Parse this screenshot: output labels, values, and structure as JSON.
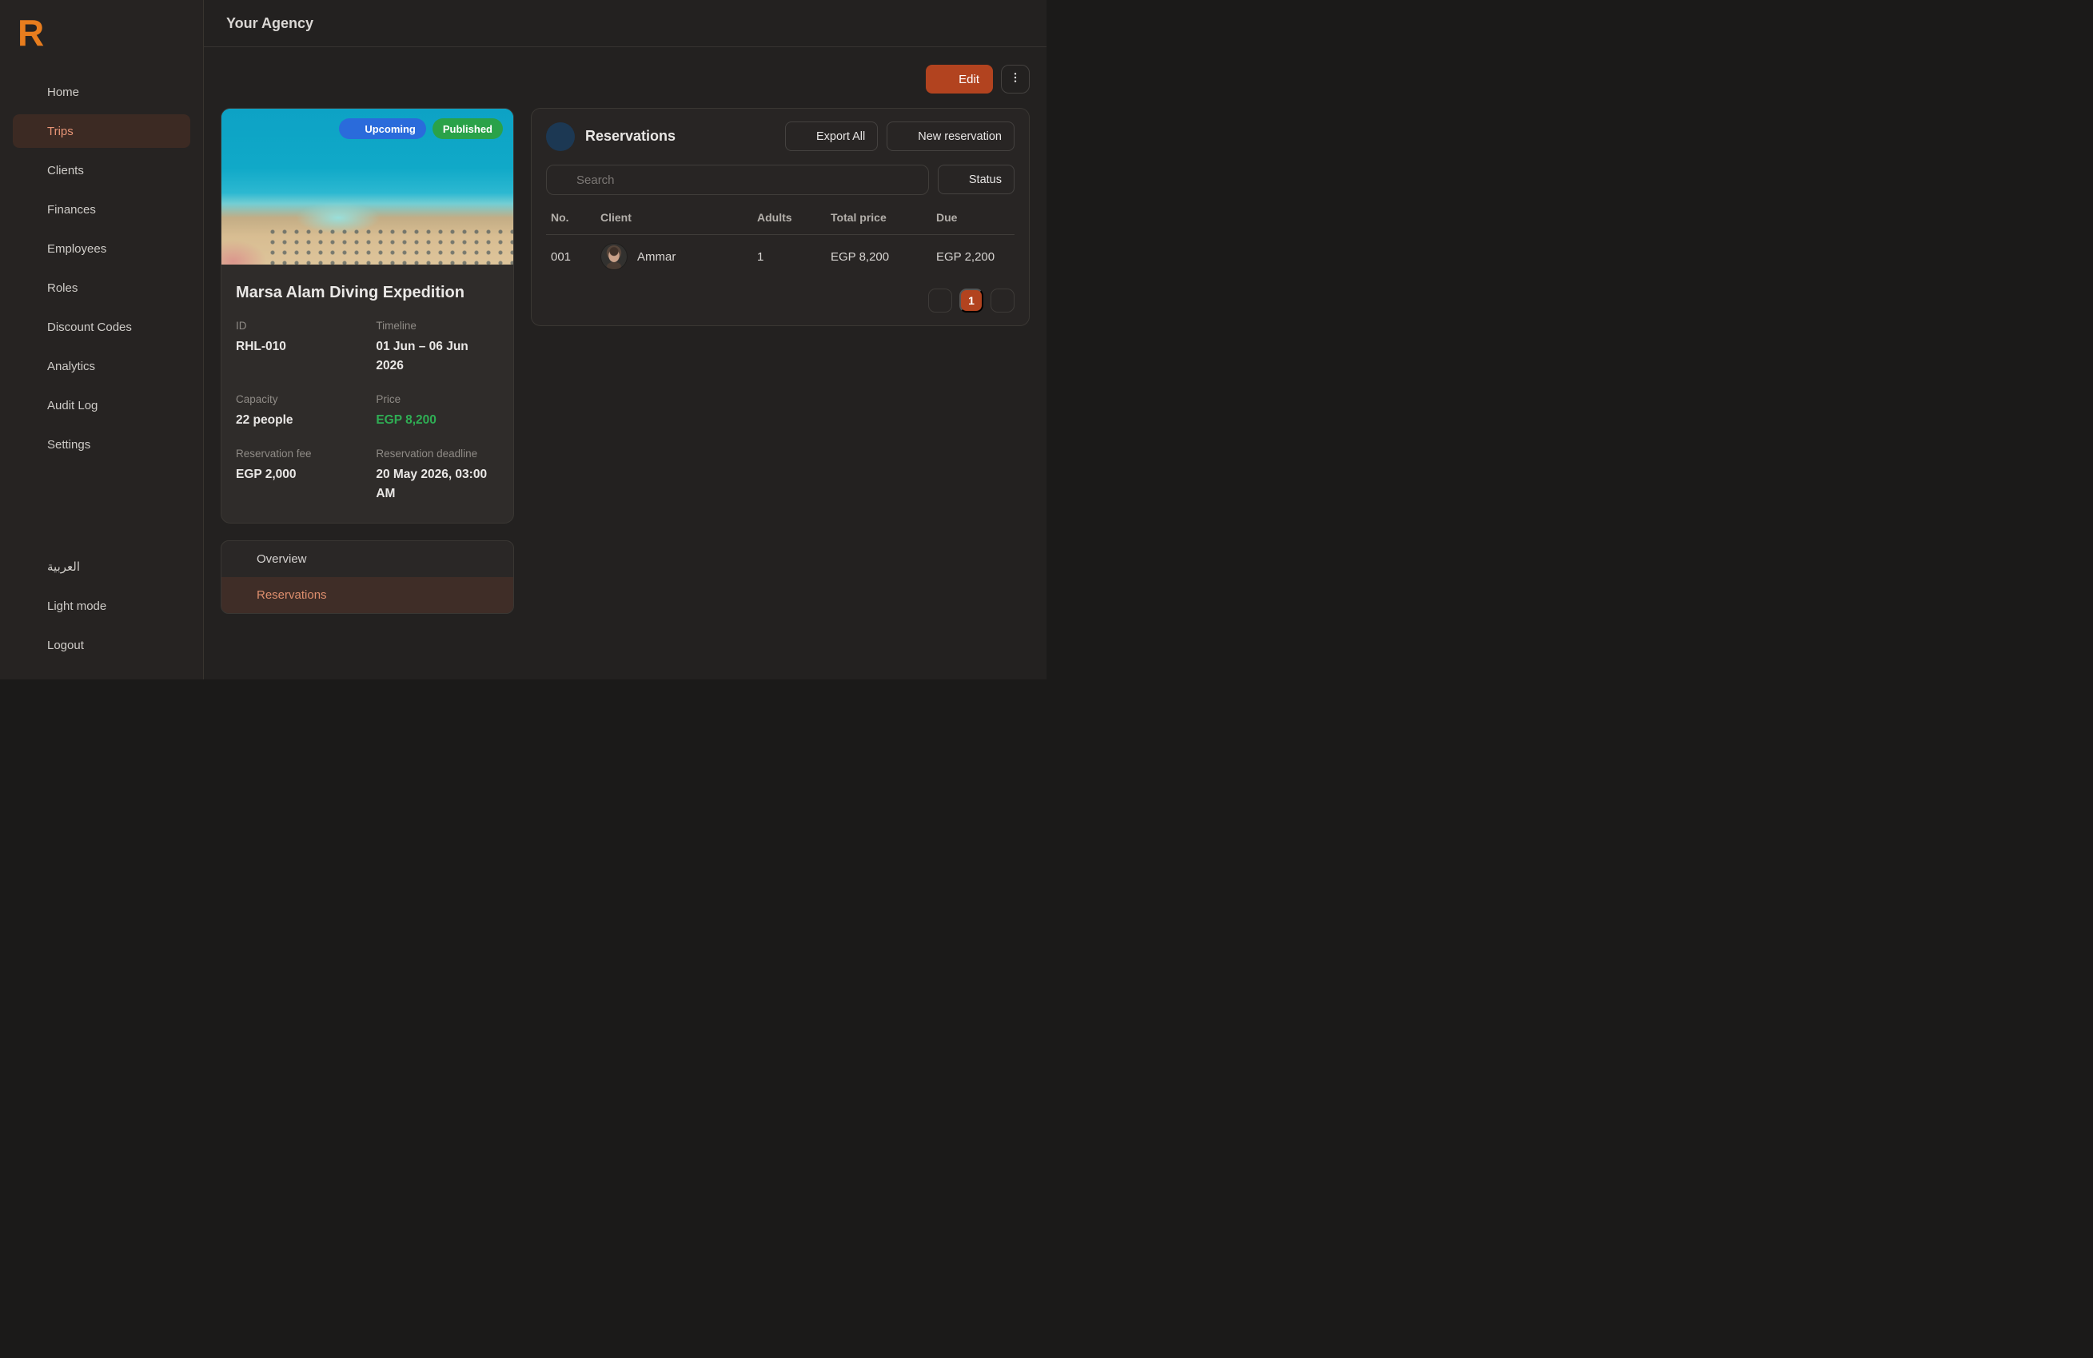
{
  "header": {
    "title": "Your Agency"
  },
  "sidebar": {
    "logo_letter": "R",
    "items": [
      {
        "label": "Home"
      },
      {
        "label": "Trips"
      },
      {
        "label": "Clients"
      },
      {
        "label": "Finances"
      },
      {
        "label": "Employees"
      },
      {
        "label": "Roles"
      },
      {
        "label": "Discount Codes"
      },
      {
        "label": "Analytics"
      },
      {
        "label": "Audit Log"
      },
      {
        "label": "Settings"
      }
    ],
    "footer_items": [
      {
        "label": "العربية"
      },
      {
        "label": "Light mode"
      },
      {
        "label": "Logout"
      }
    ]
  },
  "toolbar": {
    "edit_label": "Edit"
  },
  "trip": {
    "badges": {
      "upcoming": "Upcoming",
      "published": "Published"
    },
    "title": "Marsa Alam Diving Expedition",
    "details": [
      {
        "label": "ID",
        "value": "RHL-010"
      },
      {
        "label": "Timeline",
        "value": "01 Jun – 06 Jun 2026"
      },
      {
        "label": "Capacity",
        "value": "22 people"
      },
      {
        "label": "Price",
        "value": "EGP 8,200"
      },
      {
        "label": "Reservation fee",
        "value": "EGP 2,000"
      },
      {
        "label": "Reservation deadline",
        "value": "20 May 2026, 03:00 AM"
      }
    ]
  },
  "trip_tabs": [
    {
      "label": "Overview"
    },
    {
      "label": "Reservations"
    }
  ],
  "reservations": {
    "title": "Reservations",
    "export_label": "Export All",
    "new_label": "New reservation",
    "search_placeholder": "Search",
    "status_label": "Status",
    "table": {
      "headers": [
        "No.",
        "Client",
        "Adults",
        "Total price",
        "Due"
      ],
      "rows": [
        {
          "no": "001",
          "client": "Ammar",
          "adults": "1",
          "total": "EGP 8,200",
          "due": "EGP 2,200"
        }
      ]
    },
    "pagination": {
      "current": "1"
    }
  },
  "colors": {
    "accent_rust": "#b2431f",
    "accent_salmon": "#df8f6e",
    "logo_orange": "#e87d1e",
    "price_green": "#2fae54",
    "badge_blue": "#2a6bdb",
    "badge_green": "#2aa249",
    "reservations_icon_blue": "#3f8df5"
  }
}
